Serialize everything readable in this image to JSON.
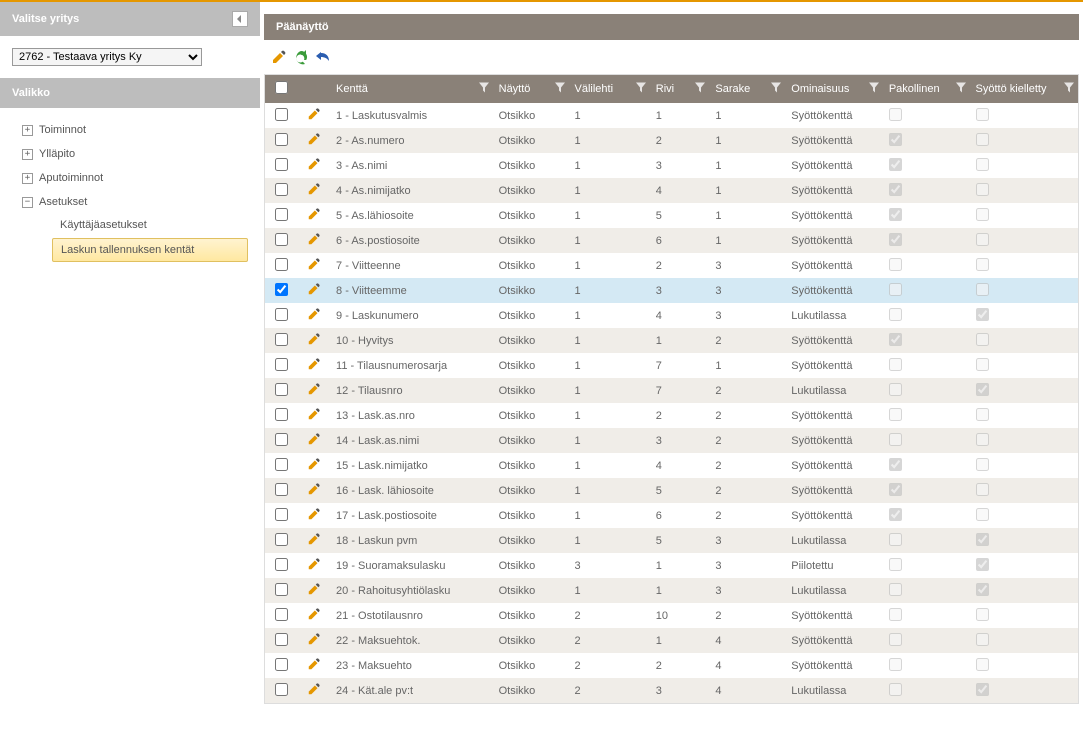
{
  "sidebar": {
    "company_header": "Valitse yritys",
    "company_selected": "2762 - Testaava yritys Ky",
    "menu_header": "Valikko",
    "nodes": [
      {
        "label": "Toiminnot",
        "expanded": false
      },
      {
        "label": "Ylläpito",
        "expanded": false
      },
      {
        "label": "Aputoiminnot",
        "expanded": false
      },
      {
        "label": "Asetukset",
        "expanded": true,
        "children": [
          {
            "label": "Käyttäjäasetukset",
            "active": false
          },
          {
            "label": "Laskun tallennuksen kentät",
            "active": true
          }
        ]
      }
    ]
  },
  "main": {
    "title": "Päänäyttö",
    "columns": {
      "kentta": "Kenttä",
      "naytto": "Näyttö",
      "valilehti": "Välilehti",
      "rivi": "Rivi",
      "sarake": "Sarake",
      "ominaisuus": "Ominaisuus",
      "pakollinen": "Pakollinen",
      "syotto": "Syöttö kielletty"
    },
    "rows": [
      {
        "sel": false,
        "kentta": "1 - Laskutusvalmis",
        "naytto": "Otsikko",
        "valil": "1",
        "rivi": "1",
        "sarake": "1",
        "omin": "Syöttökenttä",
        "pakol": false,
        "syotto": false
      },
      {
        "sel": false,
        "kentta": "2 - As.numero",
        "naytto": "Otsikko",
        "valil": "1",
        "rivi": "2",
        "sarake": "1",
        "omin": "Syöttökenttä",
        "pakol": true,
        "syotto": false
      },
      {
        "sel": false,
        "kentta": "3 - As.nimi",
        "naytto": "Otsikko",
        "valil": "1",
        "rivi": "3",
        "sarake": "1",
        "omin": "Syöttökenttä",
        "pakol": true,
        "syotto": false
      },
      {
        "sel": false,
        "kentta": "4 - As.nimijatko",
        "naytto": "Otsikko",
        "valil": "1",
        "rivi": "4",
        "sarake": "1",
        "omin": "Syöttökenttä",
        "pakol": true,
        "syotto": false
      },
      {
        "sel": false,
        "kentta": "5 - As.lähiosoite",
        "naytto": "Otsikko",
        "valil": "1",
        "rivi": "5",
        "sarake": "1",
        "omin": "Syöttökenttä",
        "pakol": true,
        "syotto": false
      },
      {
        "sel": false,
        "kentta": "6 - As.postiosoite",
        "naytto": "Otsikko",
        "valil": "1",
        "rivi": "6",
        "sarake": "1",
        "omin": "Syöttökenttä",
        "pakol": true,
        "syotto": false
      },
      {
        "sel": false,
        "kentta": "7 - Viitteenne",
        "naytto": "Otsikko",
        "valil": "1",
        "rivi": "2",
        "sarake": "3",
        "omin": "Syöttökenttä",
        "pakol": false,
        "syotto": false
      },
      {
        "sel": true,
        "kentta": "8 - Viitteemme",
        "naytto": "Otsikko",
        "valil": "1",
        "rivi": "3",
        "sarake": "3",
        "omin": "Syöttökenttä",
        "pakol": false,
        "syotto": false
      },
      {
        "sel": false,
        "kentta": "9 - Laskunumero",
        "naytto": "Otsikko",
        "valil": "1",
        "rivi": "4",
        "sarake": "3",
        "omin": "Lukutilassa",
        "pakol": false,
        "syotto": true
      },
      {
        "sel": false,
        "kentta": "10 - Hyvitys",
        "naytto": "Otsikko",
        "valil": "1",
        "rivi": "1",
        "sarake": "2",
        "omin": "Syöttökenttä",
        "pakol": true,
        "syotto": false
      },
      {
        "sel": false,
        "kentta": "11 - Tilausnumerosarja",
        "naytto": "Otsikko",
        "valil": "1",
        "rivi": "7",
        "sarake": "1",
        "omin": "Syöttökenttä",
        "pakol": false,
        "syotto": false
      },
      {
        "sel": false,
        "kentta": "12 - Tilausnro",
        "naytto": "Otsikko",
        "valil": "1",
        "rivi": "7",
        "sarake": "2",
        "omin": "Lukutilassa",
        "pakol": false,
        "syotto": true
      },
      {
        "sel": false,
        "kentta": "13 - Lask.as.nro",
        "naytto": "Otsikko",
        "valil": "1",
        "rivi": "2",
        "sarake": "2",
        "omin": "Syöttökenttä",
        "pakol": false,
        "syotto": false
      },
      {
        "sel": false,
        "kentta": "14 - Lask.as.nimi",
        "naytto": "Otsikko",
        "valil": "1",
        "rivi": "3",
        "sarake": "2",
        "omin": "Syöttökenttä",
        "pakol": false,
        "syotto": false
      },
      {
        "sel": false,
        "kentta": "15 - Lask.nimijatko",
        "naytto": "Otsikko",
        "valil": "1",
        "rivi": "4",
        "sarake": "2",
        "omin": "Syöttökenttä",
        "pakol": true,
        "syotto": false
      },
      {
        "sel": false,
        "kentta": "16 - Lask. lähiosoite",
        "naytto": "Otsikko",
        "valil": "1",
        "rivi": "5",
        "sarake": "2",
        "omin": "Syöttökenttä",
        "pakol": true,
        "syotto": false
      },
      {
        "sel": false,
        "kentta": "17 - Lask.postiosoite",
        "naytto": "Otsikko",
        "valil": "1",
        "rivi": "6",
        "sarake": "2",
        "omin": "Syöttökenttä",
        "pakol": true,
        "syotto": false
      },
      {
        "sel": false,
        "kentta": "18 - Laskun pvm",
        "naytto": "Otsikko",
        "valil": "1",
        "rivi": "5",
        "sarake": "3",
        "omin": "Lukutilassa",
        "pakol": false,
        "syotto": true
      },
      {
        "sel": false,
        "kentta": "19 - Suoramaksulasku",
        "naytto": "Otsikko",
        "valil": "3",
        "rivi": "1",
        "sarake": "3",
        "omin": "Piilotettu",
        "pakol": false,
        "syotto": true
      },
      {
        "sel": false,
        "kentta": "20 - Rahoitusyhtiölasku",
        "naytto": "Otsikko",
        "valil": "1",
        "rivi": "1",
        "sarake": "3",
        "omin": "Lukutilassa",
        "pakol": false,
        "syotto": true
      },
      {
        "sel": false,
        "kentta": "21 - Ostotilausnro",
        "naytto": "Otsikko",
        "valil": "2",
        "rivi": "10",
        "sarake": "2",
        "omin": "Syöttökenttä",
        "pakol": false,
        "syotto": false
      },
      {
        "sel": false,
        "kentta": "22 - Maksuehtok.",
        "naytto": "Otsikko",
        "valil": "2",
        "rivi": "1",
        "sarake": "4",
        "omin": "Syöttökenttä",
        "pakol": false,
        "syotto": false
      },
      {
        "sel": false,
        "kentta": "23 - Maksuehto",
        "naytto": "Otsikko",
        "valil": "2",
        "rivi": "2",
        "sarake": "4",
        "omin": "Syöttökenttä",
        "pakol": false,
        "syotto": false
      },
      {
        "sel": false,
        "kentta": "24 - Kät.ale pv:t",
        "naytto": "Otsikko",
        "valil": "2",
        "rivi": "3",
        "sarake": "4",
        "omin": "Lukutilassa",
        "pakol": false,
        "syotto": true
      }
    ]
  }
}
